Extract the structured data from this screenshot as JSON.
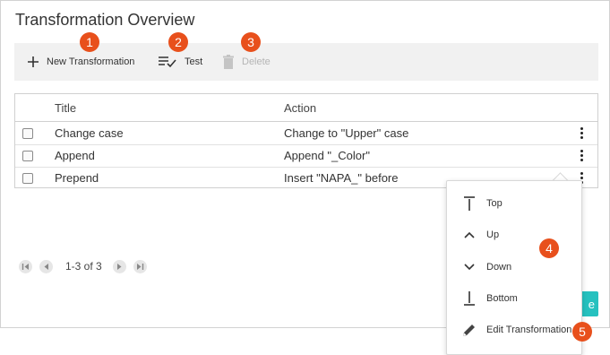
{
  "dialog": {
    "title": "Transformation Overview"
  },
  "toolbar": {
    "new_label": "New Transformation",
    "test_label": "Test",
    "delete_label": "Delete"
  },
  "table": {
    "headers": [
      "Title",
      "Action"
    ],
    "rows": [
      {
        "title": "Change case",
        "action": "Change to \"Upper\" case"
      },
      {
        "title": "Append",
        "action": "Append \"_Color\""
      },
      {
        "title": "Prepend",
        "action": "Insert \"NAPA_\" before"
      }
    ]
  },
  "pager": {
    "text": "1-3 of 3"
  },
  "context_menu": {
    "items": [
      {
        "label": "Top",
        "icon": "arrow-to-top-icon"
      },
      {
        "label": "Up",
        "icon": "chevron-up-icon"
      },
      {
        "label": "Down",
        "icon": "chevron-down-icon"
      },
      {
        "label": "Bottom",
        "icon": "arrow-to-bottom-icon"
      },
      {
        "label": "Edit Transformation",
        "icon": "pencil-icon"
      }
    ]
  },
  "callouts": [
    "1",
    "2",
    "3",
    "4",
    "5"
  ],
  "colors": {
    "callout": "#e8501c",
    "accent": "#26c1bf",
    "toolbar_bg": "#f1f1f1"
  }
}
